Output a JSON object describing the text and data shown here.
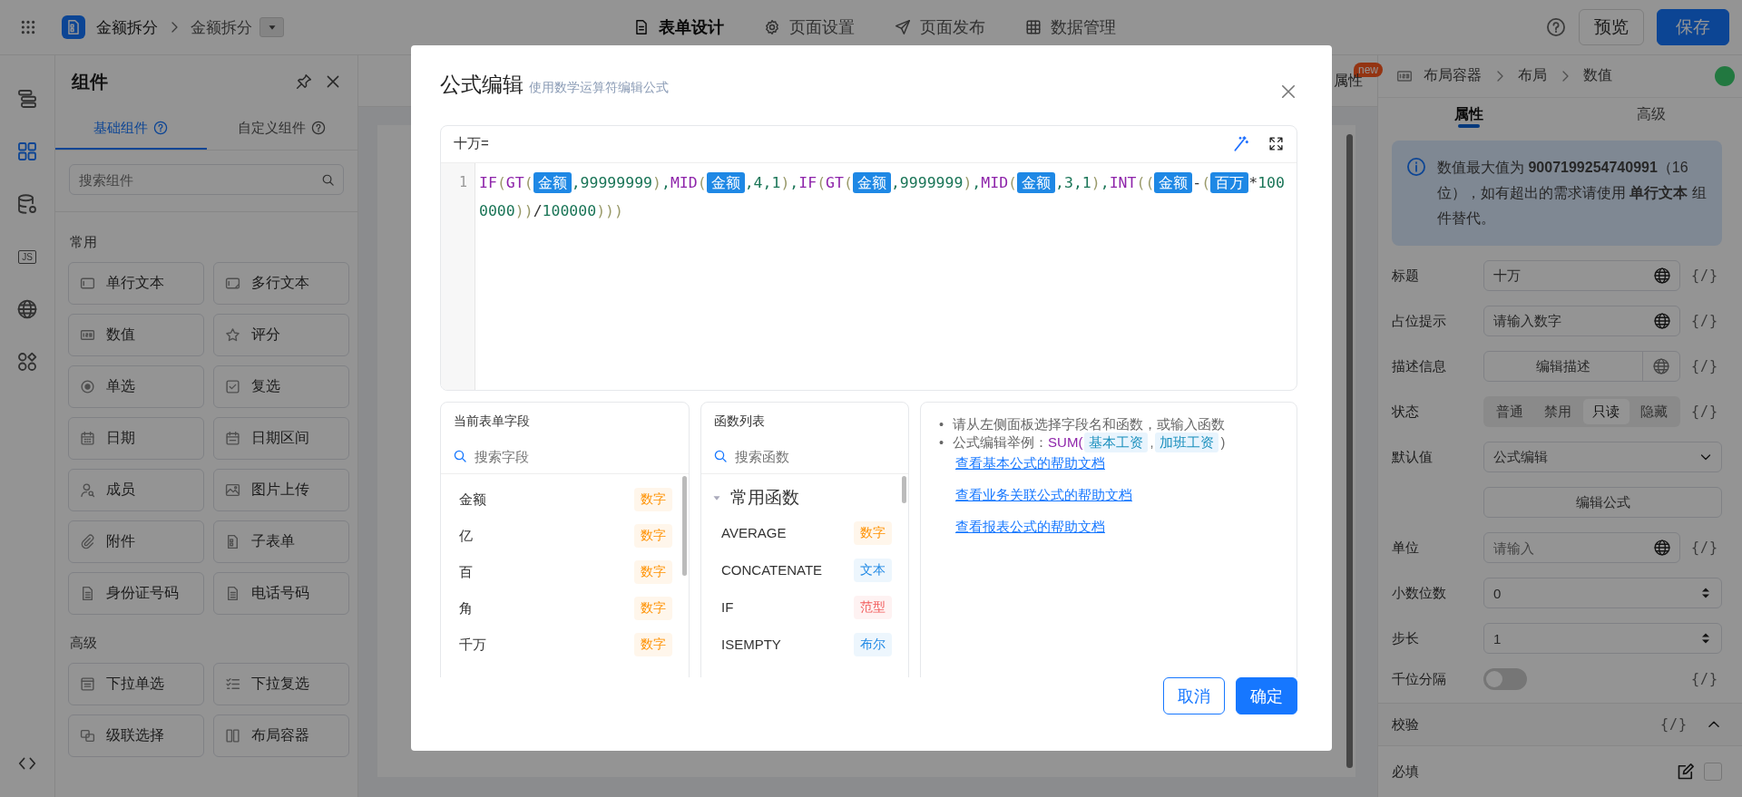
{
  "topbar": {
    "app_name": "金额拆分",
    "form_name": "金额拆分",
    "tabs": [
      {
        "label": "表单设计",
        "kind": "form",
        "selected": true
      },
      {
        "label": "页面设置",
        "kind": "settings",
        "selected": false
      },
      {
        "label": "页面发布",
        "kind": "publish",
        "selected": false
      },
      {
        "label": "数据管理",
        "kind": "data",
        "selected": false
      }
    ],
    "actions": [
      {
        "label": "预览",
        "kind": "secondary"
      },
      {
        "label": "保存",
        "kind": "primary"
      }
    ]
  },
  "rail": {
    "items": [
      {
        "kind": "outline",
        "selected": false
      },
      {
        "kind": "components",
        "selected": true
      },
      {
        "kind": "datasource",
        "selected": false
      },
      {
        "kind": "js",
        "label": "JS",
        "selected": false
      },
      {
        "kind": "globe",
        "selected": false
      },
      {
        "kind": "apps",
        "selected": false
      }
    ]
  },
  "components_panel": {
    "title": "组件",
    "tabs": [
      {
        "label": "基础组件",
        "selected": true
      },
      {
        "label": "自定义组件",
        "selected": false
      }
    ],
    "search": {
      "placeholder": "搜索组件"
    },
    "groups": [
      {
        "title": "常用",
        "items": [
          {
            "label": "单行文本",
            "kind": "text"
          },
          {
            "label": "多行文本",
            "kind": "textarea"
          },
          {
            "label": "数值",
            "kind": "number"
          },
          {
            "label": "评分",
            "kind": "rating"
          },
          {
            "label": "单选",
            "kind": "radio"
          },
          {
            "label": "复选",
            "kind": "checkbox"
          },
          {
            "label": "日期",
            "kind": "date"
          },
          {
            "label": "日期区间",
            "kind": "daterange"
          },
          {
            "label": "成员",
            "kind": "member"
          },
          {
            "label": "图片上传",
            "kind": "image"
          },
          {
            "label": "附件",
            "kind": "attachment"
          },
          {
            "label": "子表单",
            "kind": "subform"
          },
          {
            "label": "身份证号码",
            "kind": "idcard"
          },
          {
            "label": "电话号码",
            "kind": "phone"
          }
        ]
      },
      {
        "title": "高级",
        "items": [
          {
            "label": "下拉单选",
            "kind": "select"
          },
          {
            "label": "下拉复选",
            "kind": "multiselect"
          },
          {
            "label": "级联选择",
            "kind": "cascader"
          },
          {
            "label": "布局容器",
            "kind": "layout"
          }
        ]
      }
    ]
  },
  "canvas": {
    "properties_tab": {
      "label": "属性",
      "badge": "new"
    }
  },
  "properties_panel": {
    "breadcrumb": [
      "布局容器",
      "布局",
      "数值"
    ],
    "tabs": [
      {
        "label": "属性",
        "selected": true
      },
      {
        "label": "高级",
        "selected": false
      }
    ],
    "notice": "数值最大值为 **9007199254740991**（16 位），如有超出的需求请使用 **单行文本** 组件替代。",
    "fields": [
      {
        "label": "标题",
        "kind": "input",
        "value": "十万",
        "globe": true,
        "var_button": "{/}"
      },
      {
        "label": "占位提示",
        "kind": "input",
        "value": "请输入数字",
        "globe": true,
        "var_button": "{/}"
      },
      {
        "label": "描述信息",
        "kind": "button",
        "text": "编辑描述",
        "globe": true,
        "var_button": "{/}"
      },
      {
        "label": "状态",
        "kind": "segmented",
        "options": [
          {
            "label": "普通",
            "selected": false
          },
          {
            "label": "禁用",
            "selected": false
          },
          {
            "label": "只读",
            "selected": true
          },
          {
            "label": "隐藏",
            "selected": false
          }
        ],
        "var_button": "{/}"
      },
      {
        "label": "默认值",
        "kind": "select",
        "value": "公式编辑"
      },
      {
        "kind": "wide-button",
        "text": "编辑公式"
      },
      {
        "label": "单位",
        "kind": "input",
        "placeholder": "请输入",
        "globe": true,
        "var_button": "{/}"
      },
      {
        "label": "小数位数",
        "kind": "number",
        "value": "0"
      },
      {
        "label": "步长",
        "kind": "number",
        "value": "1"
      },
      {
        "label": "千位分隔",
        "kind": "switch",
        "on": false,
        "var_button": "{/}"
      }
    ],
    "validation": {
      "title": "校验",
      "var_button": "{/}",
      "expanded": true,
      "rows": [
        {
          "label": "必填",
          "checked": false
        }
      ]
    }
  },
  "modal": {
    "title": "公式编辑",
    "subtitle": "使用数学运算符编辑公式",
    "editor": {
      "target_label": "十万=",
      "line_numbers": [
        "1"
      ],
      "formula": [
        {
          "kind": "func",
          "text": "IF"
        },
        {
          "kind": "paren",
          "text": "("
        },
        {
          "kind": "func",
          "text": "GT"
        },
        {
          "kind": "paren",
          "text": "("
        },
        {
          "kind": "field",
          "text": "金额"
        },
        {
          "kind": "num",
          "text": ",99999999"
        },
        {
          "kind": "paren",
          "text": ")"
        },
        {
          "kind": "num",
          "text": ","
        },
        {
          "kind": "func",
          "text": "MID"
        },
        {
          "kind": "paren",
          "text": "("
        },
        {
          "kind": "field",
          "text": "金额"
        },
        {
          "kind": "num",
          "text": ",4,1"
        },
        {
          "kind": "paren",
          "text": ")"
        },
        {
          "kind": "num",
          "text": ","
        },
        {
          "kind": "func",
          "text": "IF"
        },
        {
          "kind": "paren",
          "text": "("
        },
        {
          "kind": "func",
          "text": "GT"
        },
        {
          "kind": "paren",
          "text": "("
        },
        {
          "kind": "field",
          "text": "金额"
        },
        {
          "kind": "num",
          "text": ",9999999"
        },
        {
          "kind": "paren",
          "text": ")"
        },
        {
          "kind": "num",
          "text": ","
        },
        {
          "kind": "func",
          "text": "MID"
        },
        {
          "kind": "paren",
          "text": "("
        },
        {
          "kind": "field",
          "text": "金额"
        },
        {
          "kind": "num",
          "text": ",3,1"
        },
        {
          "kind": "paren",
          "text": ")"
        },
        {
          "kind": "num",
          "text": ","
        },
        {
          "kind": "func",
          "text": "INT"
        },
        {
          "kind": "paren",
          "text": "(("
        },
        {
          "kind": "field",
          "text": "金额"
        },
        {
          "kind": "op",
          "text": "-"
        },
        {
          "kind": "paren",
          "text": "("
        },
        {
          "kind": "field",
          "text": "百万"
        },
        {
          "kind": "op",
          "text": "*"
        },
        {
          "kind": "num",
          "text": "1000000"
        },
        {
          "kind": "paren",
          "text": "))"
        },
        {
          "kind": "op",
          "text": "/"
        },
        {
          "kind": "num",
          "text": "100000"
        },
        {
          "kind": "paren",
          "text": ")))"
        }
      ]
    },
    "fields_panel": {
      "title": "当前表单字段",
      "search": {
        "placeholder": "搜索字段"
      },
      "items": [
        {
          "name": "金额",
          "type": "数字",
          "color": "#ff9100"
        },
        {
          "name": "亿",
          "type": "数字",
          "color": "#ff9100"
        },
        {
          "name": "百",
          "type": "数字",
          "color": "#ff9100"
        },
        {
          "name": "角",
          "type": "数字",
          "color": "#ff9100"
        },
        {
          "name": "千万",
          "type": "数字",
          "color": "#ff9100"
        }
      ]
    },
    "functions_panel": {
      "title": "函数列表",
      "search": {
        "placeholder": "搜索函数"
      },
      "groups": [
        {
          "title": "常用函数",
          "expanded": true,
          "items": [
            {
              "name": "AVERAGE",
              "type": "数字",
              "color": "#ff9100"
            },
            {
              "name": "CONCATENATE",
              "type": "文本",
              "color": "#1e88e5"
            },
            {
              "name": "IF",
              "type": "范型",
              "color": "#f25c5c"
            },
            {
              "name": "ISEMPTY",
              "type": "布尔",
              "color": "#1e88e5"
            }
          ]
        }
      ]
    },
    "help": {
      "tips": [
        {
          "kind": "text",
          "marker": "•",
          "text": "请从左侧面板选择字段名和函数，或输入函数"
        },
        {
          "kind": "example",
          "marker": "•",
          "label": "公式编辑举例：",
          "func": "SUM(",
          "args": [
            "基本工资",
            "加班工资"
          ],
          "separator": ",",
          "close": ")"
        }
      ],
      "links": [
        "查看基本公式的帮助文档",
        "查看业务关联公式的帮助文档",
        "查看报表公式的帮助文档"
      ]
    },
    "buttons": [
      {
        "label": "取消",
        "kind": "secondary"
      },
      {
        "label": "确定",
        "kind": "primary"
      }
    ]
  }
}
